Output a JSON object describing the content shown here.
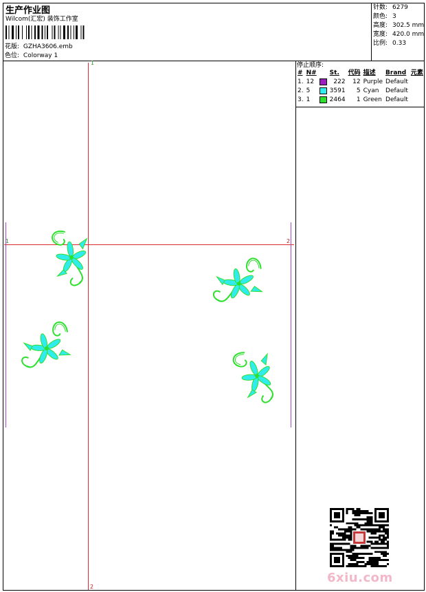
{
  "header": {
    "title": "生产作业图",
    "company": "Wilcom(汇宏) 装饰工作室",
    "design_label": "花版:",
    "design_value": "GZHA3606.emb",
    "colorway_label": "色位:",
    "colorway_value": "Colorway 1"
  },
  "specs": [
    {
      "label": "针数:",
      "value": "6279"
    },
    {
      "label": "颜色:",
      "value": "3"
    },
    {
      "label": "高度:",
      "value": "302.5 mm"
    },
    {
      "label": "宽度:",
      "value": "420.0 mm"
    },
    {
      "label": "比例:",
      "value": "0.33"
    }
  ],
  "stop_sequence": {
    "title": "停止顺序:",
    "columns": [
      "#",
      "N#",
      "St.",
      "代码",
      "描述",
      "Brand",
      "元素"
    ],
    "rows": [
      {
        "idx": "1.",
        "n": "12",
        "color": "#9a1fbf",
        "stitches": "222",
        "code": "12",
        "desc": "Purple",
        "brand": "Default"
      },
      {
        "idx": "2.",
        "n": "5",
        "color": "#31ecec",
        "stitches": "3591",
        "code": "5",
        "desc": "Cyan",
        "brand": "Default"
      },
      {
        "idx": "3.",
        "n": "1",
        "color": "#2ee02e",
        "stitches": "2464",
        "code": "1",
        "desc": "Green",
        "brand": "Default"
      }
    ]
  },
  "canvas": {
    "markers": {
      "top": "1",
      "bottom": "2",
      "left": "1",
      "right": "2"
    }
  },
  "watermark": "6xiu.com",
  "colors": {
    "guide": "#e0282e",
    "outline": "#a44ac8",
    "leaf": "#2ee02e",
    "petal": "#31ecec"
  }
}
